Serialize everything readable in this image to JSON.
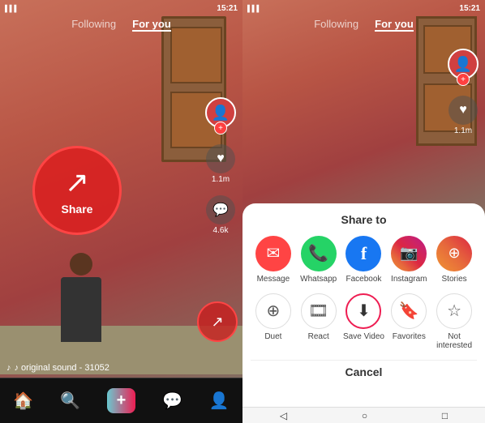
{
  "left": {
    "status_time": "15:21",
    "nav_following": "Following",
    "nav_foryou": "For you",
    "heart_count": "1.1m",
    "comment_count": "4.6k",
    "share_label": "Share",
    "music_info": "♪  original sound - 31052",
    "nav_items": [
      "🏠",
      "+",
      "💬",
      "👤"
    ],
    "bottom_sys": [
      "◁",
      "○",
      "□"
    ]
  },
  "right": {
    "status_time": "15:21",
    "nav_following": "Following",
    "nav_foryou": "For you",
    "heart_count": "1.1m",
    "share_to_title": "Share to",
    "share_row1": [
      {
        "label": "Message",
        "icon": "💬",
        "color": "msg"
      },
      {
        "label": "Whatsapp",
        "icon": "📱",
        "color": "whatsapp"
      },
      {
        "label": "Facebook",
        "icon": "f",
        "color": "fb"
      },
      {
        "label": "Instagram",
        "icon": "📷",
        "color": "insta"
      },
      {
        "label": "Stories",
        "icon": "⊕",
        "color": "stories"
      }
    ],
    "share_row2": [
      {
        "label": "Duet",
        "icon": "⊕"
      },
      {
        "label": "React",
        "icon": "🎞"
      },
      {
        "label": "Save Video",
        "icon": "⬇"
      },
      {
        "label": "Favorites",
        "icon": "🔖"
      },
      {
        "label": "Not interested",
        "icon": "☆"
      }
    ],
    "cancel_label": "Cancel",
    "bottom_sys": [
      "◁",
      "○",
      "□"
    ]
  }
}
